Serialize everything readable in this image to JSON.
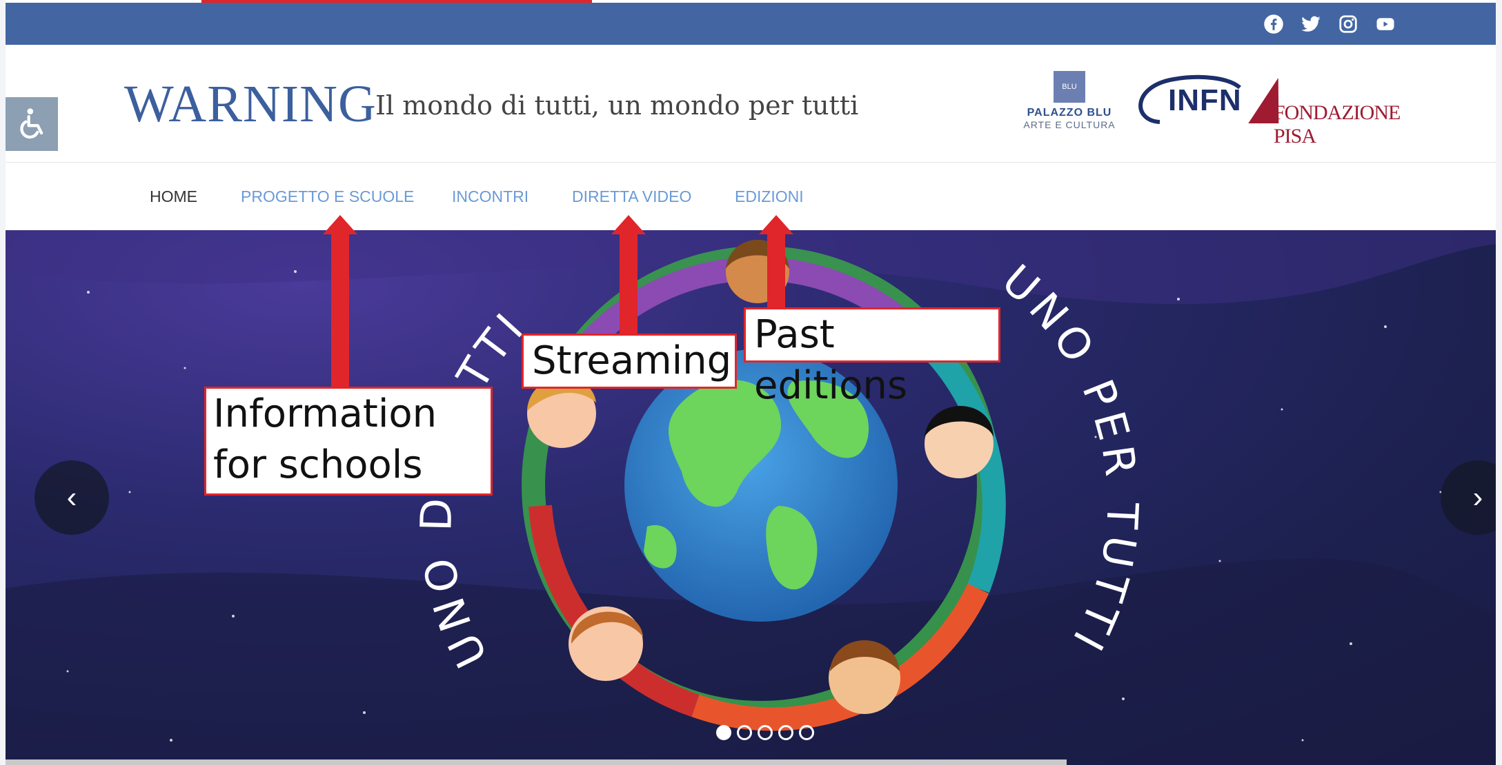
{
  "social": [
    "facebook-icon",
    "twitter-icon",
    "instagram-icon",
    "youtube-icon"
  ],
  "header": {
    "logo": "WARNING",
    "tagline": "Il mondo di tutti, un mondo per tutti",
    "partners": {
      "palazzo_mark": "BLU",
      "palazzo_name": "PALAZZO BLU",
      "palazzo_sub": "ARTE E CULTURA",
      "infn": "INFN",
      "fondazione": "FONDAZIONE PISA"
    }
  },
  "nav": {
    "items": [
      {
        "label": "HOME",
        "active": true
      },
      {
        "label": "PROGETTO E SCUOLE",
        "active": false
      },
      {
        "label": "INCONTRI",
        "active": false
      },
      {
        "label": "DIRETTA VIDEO",
        "active": false
      },
      {
        "label": "EDIZIONI",
        "active": false
      }
    ]
  },
  "hero": {
    "arc_left": "UNO DI TUTTI",
    "arc_right": "UNO PER TUTTI",
    "slide_count": 5,
    "active_slide": 1,
    "prev_icon": "chevron-left-icon",
    "next_icon": "chevron-right-icon"
  },
  "annotations": {
    "schools": "Information for schools",
    "streaming": "Streaming",
    "past": "Past editions"
  },
  "colors": {
    "topbar": "#4366a3",
    "logo": "#3c5f9e",
    "nav_link": "#6a9ad6",
    "nav_active": "#333333",
    "annotation": "#e0262b"
  }
}
